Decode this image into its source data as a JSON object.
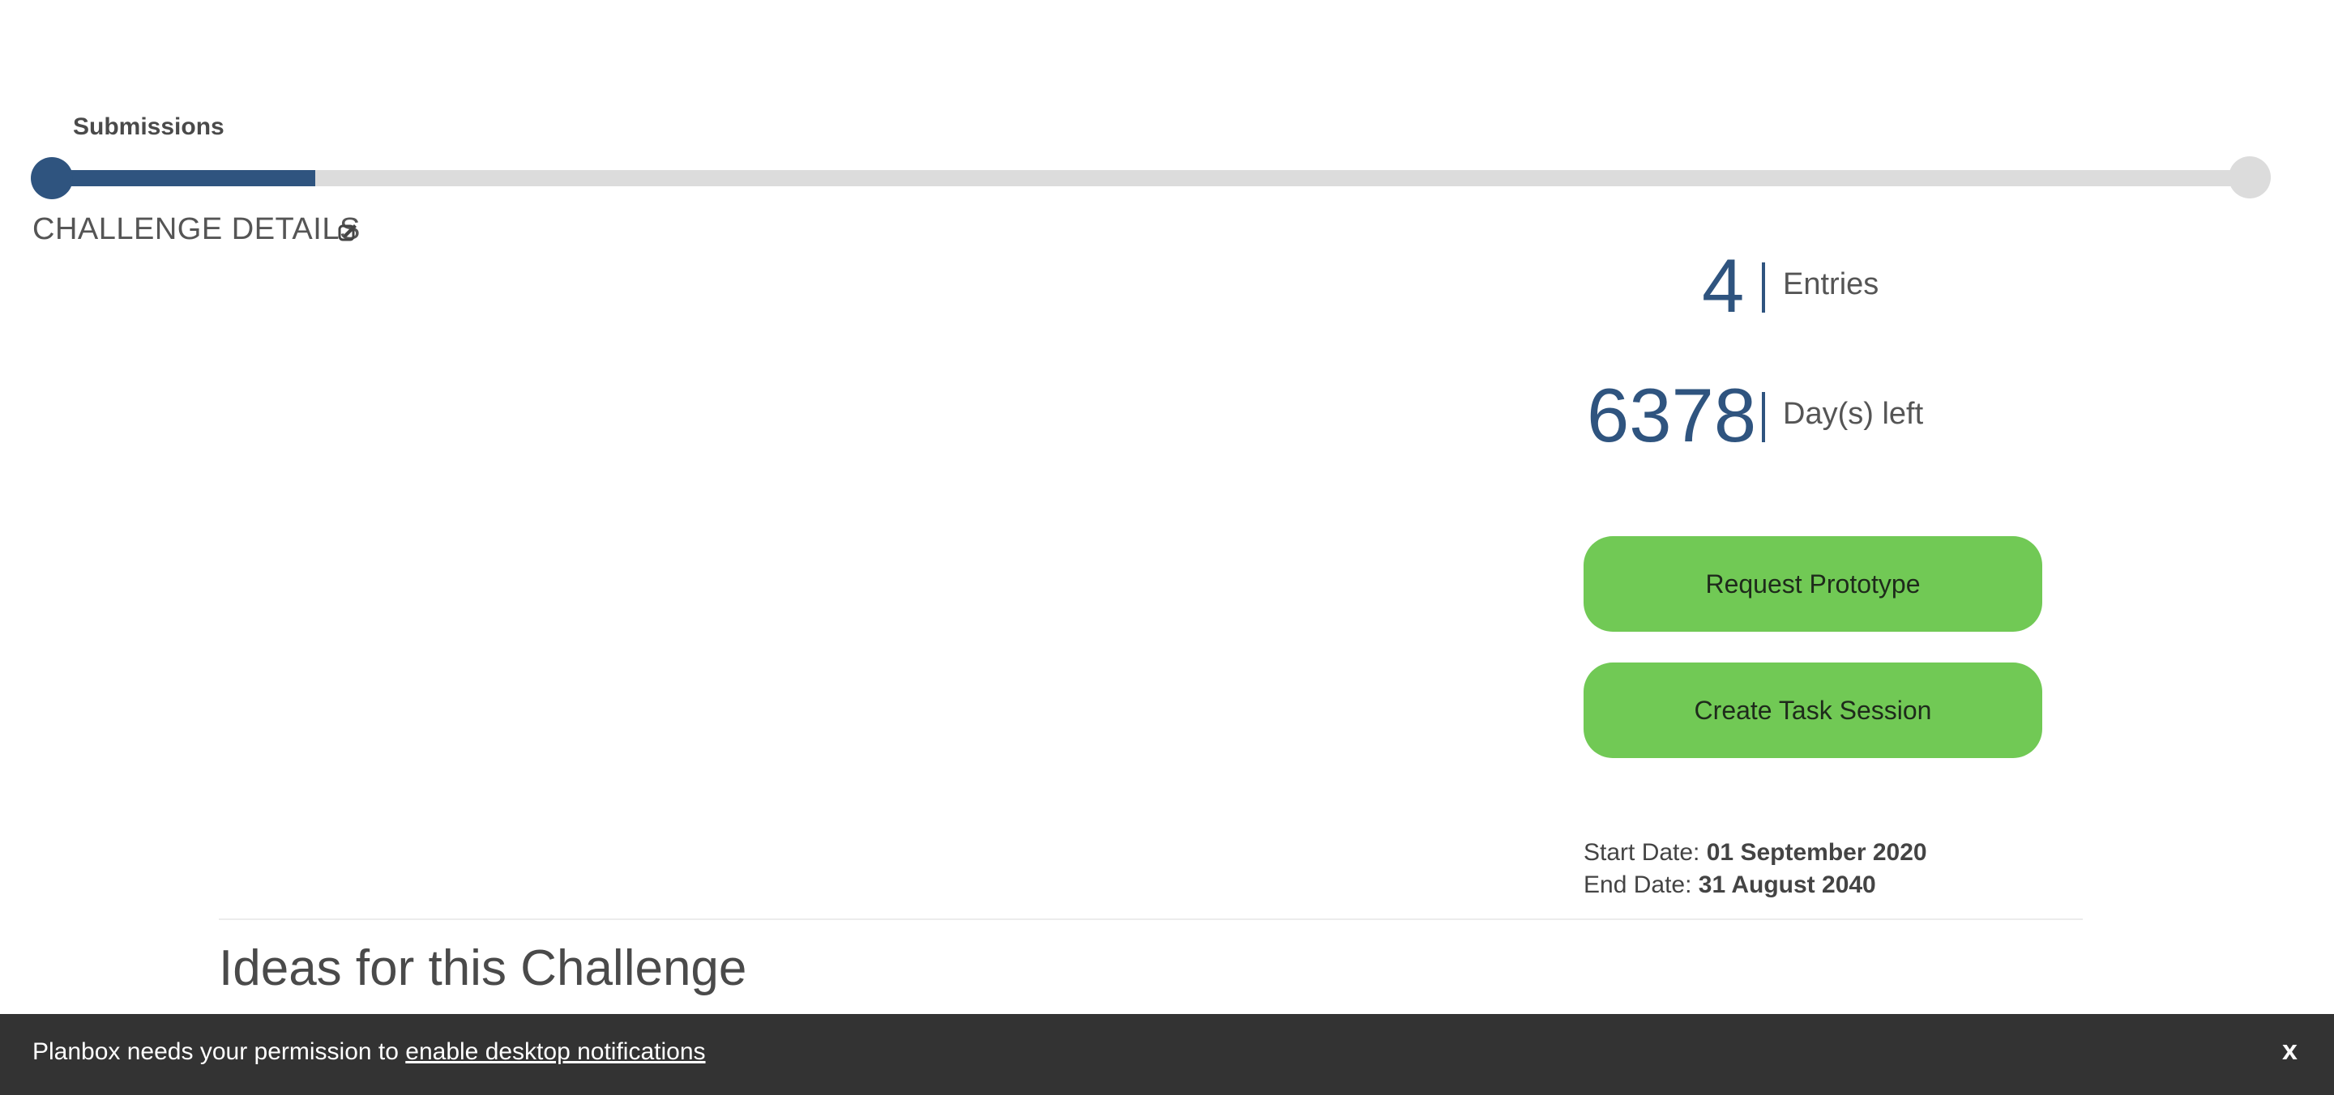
{
  "stage": {
    "label": "Submissions",
    "progress_fraction": 0.12
  },
  "challenge": {
    "section_title": "CHALLENGE DETAILS",
    "edit_icon": "edit-icon"
  },
  "stats": {
    "entries_value": "4",
    "entries_label": "Entries",
    "days_value": "6378",
    "days_label": "Day(s) left"
  },
  "actions": {
    "request_prototype": "Request Prototype",
    "create_task_session": "Create Task Session"
  },
  "dates": {
    "start_label": "Start Date:",
    "start_value": "01 September 2020",
    "end_label": "End Date:",
    "end_value": "31 August 2040"
  },
  "ideas": {
    "title": "Ideas for this Challenge"
  },
  "notification": {
    "text": "Planbox needs your permission to",
    "link": "enable desktop notifications",
    "close": "x"
  },
  "colors": {
    "accent": "#2f547f",
    "button": "#71c955",
    "track": "#dcdcdc",
    "notification_bg": "#333333"
  }
}
